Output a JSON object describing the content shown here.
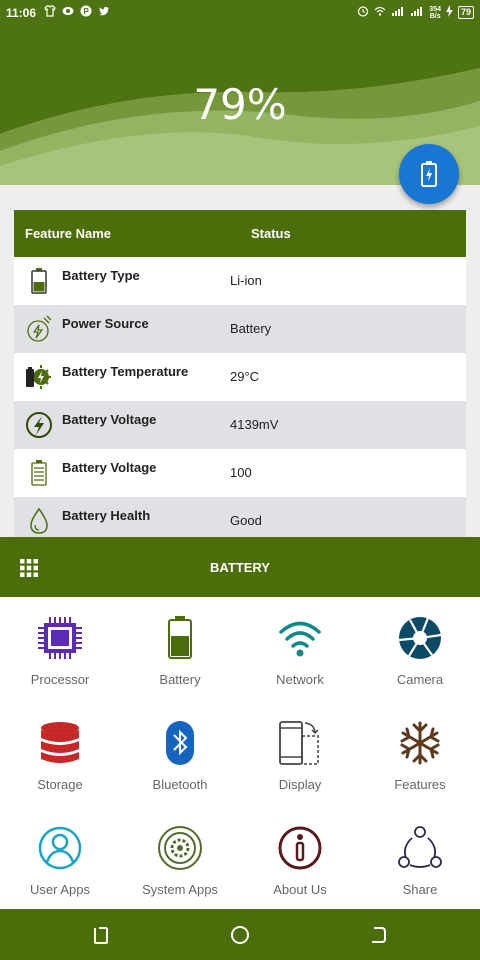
{
  "status_bar": {
    "time": "11:06",
    "net_speed_top": "354",
    "net_speed_bottom": "B/s",
    "battery": "79"
  },
  "header": {
    "percent": "79%"
  },
  "table": {
    "col_feature": "Feature Name",
    "col_status": "Status",
    "rows": [
      {
        "name": "Battery Type",
        "value": "Li-ion"
      },
      {
        "name": "Power Source",
        "value": "Battery"
      },
      {
        "name": "Battery Temperature",
        "value": "29°C"
      },
      {
        "name": "Battery Voltage",
        "value": "4139mV"
      },
      {
        "name": "Battery Voltage",
        "value": "100"
      },
      {
        "name": "Battery Health",
        "value": "Good"
      }
    ]
  },
  "sheet": {
    "title": "BATTERY"
  },
  "menu": {
    "items": [
      {
        "label": "Processor"
      },
      {
        "label": "Battery"
      },
      {
        "label": "Network"
      },
      {
        "label": "Camera"
      },
      {
        "label": "Storage"
      },
      {
        "label": "Bluetooth"
      },
      {
        "label": "Display"
      },
      {
        "label": "Features"
      },
      {
        "label": "User Apps"
      },
      {
        "label": "System Apps"
      },
      {
        "label": "About Us"
      },
      {
        "label": "Share"
      }
    ]
  },
  "colors": {
    "primary": "#4c6e0a",
    "header_light": "#a7c47d",
    "fab": "#1976d2",
    "row_alt": "#dfe1e5"
  }
}
